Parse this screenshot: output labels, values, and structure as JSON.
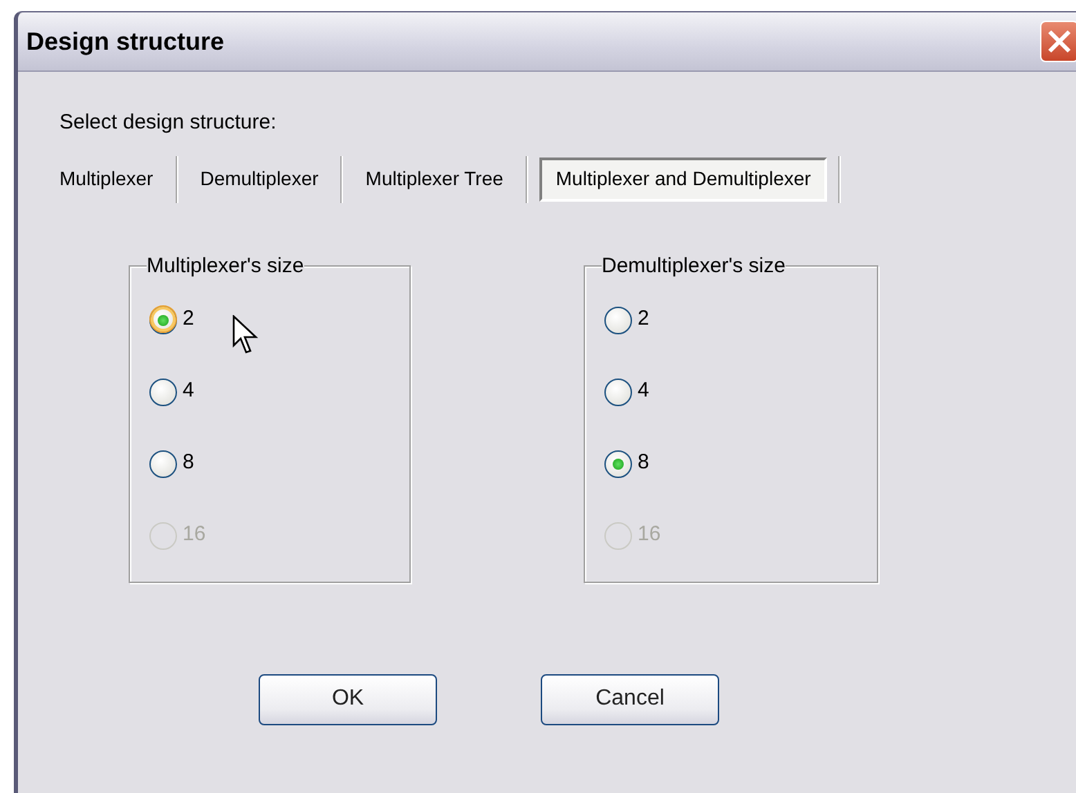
{
  "window": {
    "title": "Design structure"
  },
  "prompt": "Select design structure:",
  "tabs": [
    {
      "label": "Multiplexer",
      "selected": false
    },
    {
      "label": "Demultiplexer",
      "selected": false
    },
    {
      "label": "Multiplexer Tree",
      "selected": false
    },
    {
      "label": "Multiplexer and Demultiplexer",
      "selected": true
    }
  ],
  "groups": [
    {
      "title": "Multiplexer's size",
      "options": [
        {
          "label": "2",
          "selected": true,
          "disabled": false,
          "hovered": true
        },
        {
          "label": "4",
          "selected": false,
          "disabled": false
        },
        {
          "label": "8",
          "selected": false,
          "disabled": false
        },
        {
          "label": "16",
          "selected": false,
          "disabled": true
        }
      ]
    },
    {
      "title": "Demultiplexer's size",
      "options": [
        {
          "label": "2",
          "selected": false,
          "disabled": false
        },
        {
          "label": "4",
          "selected": false,
          "disabled": false
        },
        {
          "label": "8",
          "selected": true,
          "disabled": false
        },
        {
          "label": "16",
          "selected": false,
          "disabled": true
        }
      ]
    }
  ],
  "buttons": [
    "OK",
    "Cancel"
  ]
}
